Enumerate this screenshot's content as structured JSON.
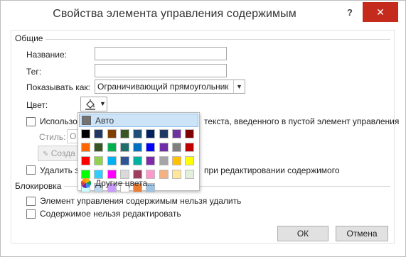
{
  "dialog": {
    "title": "Свойства элемента управления содержимым",
    "help_label": "?",
    "close_label": "✕"
  },
  "general": {
    "section_label": "Общие",
    "name_label": "Название:",
    "name_value": "",
    "tag_label": "Тег:",
    "tag_value": "",
    "show_as_label": "Показывать как:",
    "show_as_value": "Ограничивающий прямоугольник",
    "color_label": "Цвет:",
    "use_style_label_left": "Использов",
    "use_style_label_right": "текста, введенного в пустой элемент управления",
    "style_label": "Стиль:",
    "style_value": "О",
    "create_style_label": "Созда",
    "remove_label_left": "Удалить эл",
    "remove_label_right": "при редактировании содержимого"
  },
  "color_popup": {
    "auto_label": "Авто",
    "more_colors_label": "Другие цвета...",
    "swatches": [
      "#000000",
      "#1f3864",
      "#7f3f00",
      "#375623",
      "#1f4e79",
      "#002060",
      "#203864",
      "#7030a0",
      "#7f0000",
      "#ff6600",
      "#375623",
      "#00b050",
      "#1f6e6e",
      "#0070c0",
      "#0000ff",
      "#6f2da8",
      "#808080",
      "#c00000",
      "#ff0000",
      "#92d050",
      "#00b0f0",
      "#2f5597",
      "#00b0a0",
      "#7f2aaa",
      "#a5a5a5",
      "#ffc000",
      "#ffff00",
      "#00ff00",
      "#33ccff",
      "#ff00ff",
      "#d9d9d9",
      "#9e3d5e",
      "#ff99cc",
      "#f4b183",
      "#ffe699",
      "#e2efda",
      "#ccffff",
      "#bdd7ee",
      "#cc99ff",
      "#ffffff",
      "#ed7d31",
      "#9dc3e6"
    ]
  },
  "lock": {
    "section_label": "Блокировка",
    "cannot_delete_label": "Элемент управления содержимым нельзя удалить",
    "cannot_edit_label": "Содержимое нельзя редактировать"
  },
  "buttons": {
    "ok_label": "ОК",
    "cancel_label": "Отмена"
  }
}
